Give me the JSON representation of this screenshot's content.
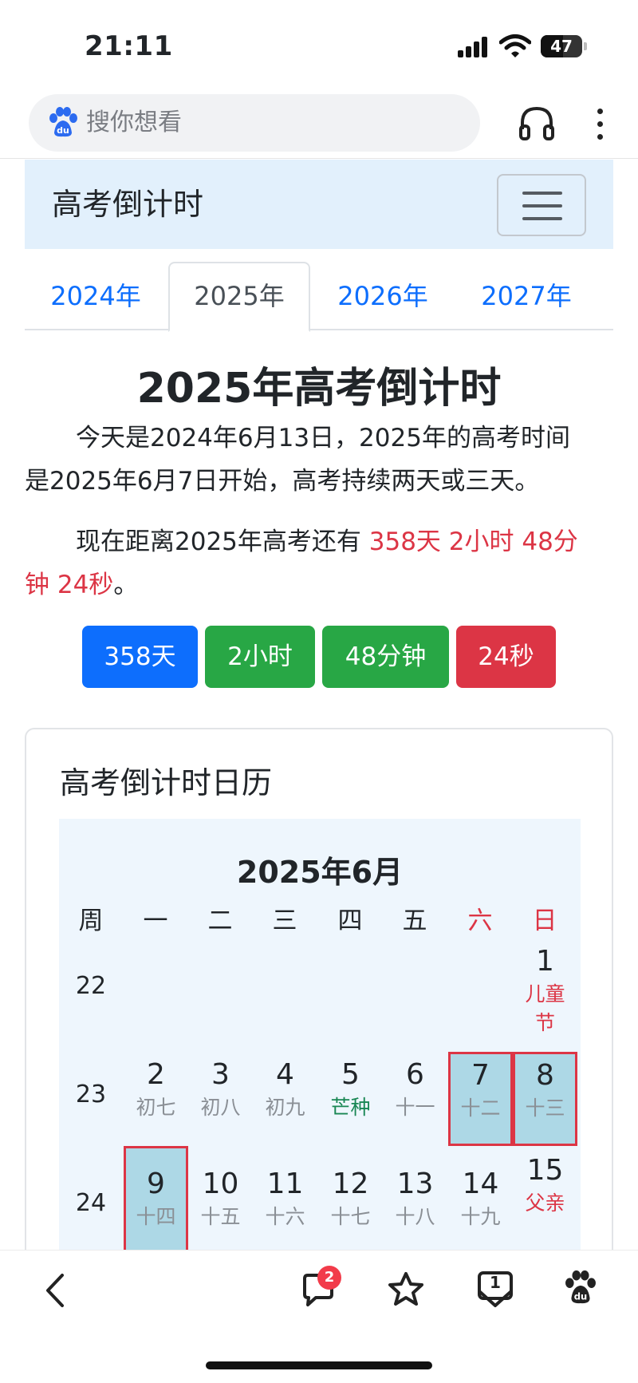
{
  "status": {
    "time": "21:11",
    "battery": "47"
  },
  "browser": {
    "search_placeholder": "搜你想看"
  },
  "navbar": {
    "brand": "高考倒计时"
  },
  "tabs": [
    {
      "label": "2024年",
      "active": false
    },
    {
      "label": "2025年",
      "active": true
    },
    {
      "label": "2026年",
      "active": false
    },
    {
      "label": "2027年",
      "active": false
    }
  ],
  "page": {
    "title": "2025年高考倒计时",
    "intro_line1": "今天是2024年6月13日，2025年的高考时间",
    "intro_line2": "是2025年6月7日开始，高考持续两天或三天。",
    "remain_prefix": "现在距离2025年高考还有 ",
    "remain_value_line1": "358天 2小时 48分",
    "remain_value_line2": "钟 24秒",
    "remain_suffix": "。"
  },
  "badges": {
    "days": "358天",
    "hours": "2小时",
    "minutes": "48分钟",
    "seconds": "24秒"
  },
  "colors": {
    "primary": "#0d6efd",
    "success": "#28a745",
    "danger": "#dc3545",
    "navbar_bg": "#e2f0fc",
    "calendar_bg": "#eef6fd",
    "exam_day_bg": "#add8e6"
  },
  "calendar": {
    "card_title": "高考倒计时日历",
    "month_title": "2025年6月",
    "headers": [
      "周",
      "一",
      "二",
      "三",
      "四",
      "五",
      "六",
      "日"
    ],
    "weeks": [
      {
        "week": "22",
        "days": [
          {
            "num": "1",
            "lunar_line1": "儿童",
            "lunar_line2": "节",
            "kind": "holiday",
            "col": 7
          }
        ]
      },
      {
        "week": "23",
        "days": [
          {
            "num": "2",
            "lunar": "初七",
            "kind": "normal",
            "col": 1
          },
          {
            "num": "3",
            "lunar": "初八",
            "kind": "normal",
            "col": 2
          },
          {
            "num": "4",
            "lunar": "初九",
            "kind": "normal",
            "col": 3
          },
          {
            "num": "5",
            "lunar": "芒种",
            "kind": "term",
            "col": 4
          },
          {
            "num": "6",
            "lunar": "十一",
            "kind": "normal",
            "col": 5
          },
          {
            "num": "7",
            "lunar": "十二",
            "kind": "exam",
            "col": 6
          },
          {
            "num": "8",
            "lunar": "十三",
            "kind": "exam",
            "col": 7
          }
        ]
      },
      {
        "week": "24",
        "days": [
          {
            "num": "9",
            "lunar": "十四",
            "kind": "exam",
            "col": 1
          },
          {
            "num": "10",
            "lunar": "十五",
            "kind": "normal",
            "col": 2
          },
          {
            "num": "11",
            "lunar": "十六",
            "kind": "normal",
            "col": 3
          },
          {
            "num": "12",
            "lunar": "十七",
            "kind": "normal",
            "col": 4
          },
          {
            "num": "13",
            "lunar": "十八",
            "kind": "normal",
            "col": 5
          },
          {
            "num": "14",
            "lunar": "十九",
            "kind": "normal",
            "col": 6
          },
          {
            "num": "15",
            "lunar": "父亲",
            "kind": "holiday",
            "col": 7
          }
        ]
      }
    ]
  },
  "toolbar": {
    "message_count": "2",
    "tab_count": "1",
    "icons": [
      "back-icon",
      "message-icon",
      "favorite-icon",
      "tabs-icon",
      "baidu-icon"
    ]
  }
}
